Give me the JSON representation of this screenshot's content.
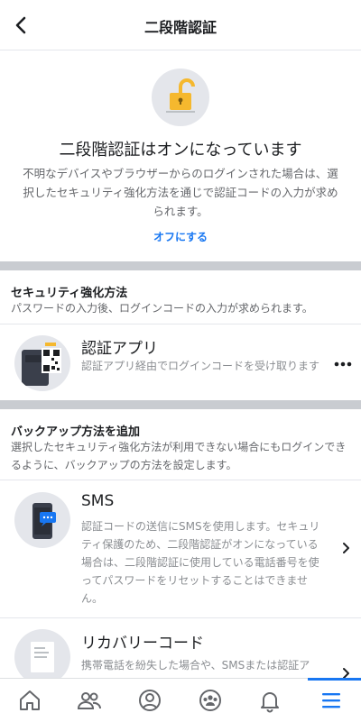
{
  "header": {
    "title": "二段階認証"
  },
  "status": {
    "title": "二段階認証はオンになっています",
    "description": "不明なデバイスやブラウザーからのログインされた場合は、選択したセキュリティ強化方法を通じで認証コードの入力が求められます。",
    "turn_off_label": "オフにする"
  },
  "security_method": {
    "heading": "セキュリティ強化方法",
    "description": "パスワードの入力後、ログインコードの入力が求められます。",
    "item": {
      "title": "認証アプリ",
      "description": "認証アプリ経由でログインコードを受け取ります"
    }
  },
  "backup": {
    "heading": "バックアップ方法を追加",
    "description": "選択したセキュリティ強化方法が利用できない場合にもログインできるように、バックアップの方法を設定します。",
    "items": [
      {
        "title": "SMS",
        "description": "認証コードの送信にSMSを使用します。セキュリティ保護のため、二段階認証がオンになっている場合は、二段階認証に使用している電話番号を使ってパスワードをリセットすることはできません。"
      },
      {
        "title": "リカバリーコード",
        "description": "携帯電話を紛失した場合や、SMSまたは認証ア"
      }
    ]
  },
  "tabbar": {
    "tabs": [
      "home-icon",
      "friends-icon",
      "profile-icon",
      "groups-icon",
      "notifications-icon",
      "menu-icon"
    ],
    "active": "menu-icon",
    "accent": "#1877f2"
  },
  "colors": {
    "link": "#1877f2",
    "lock": "#f5b82e",
    "separator": "#c9ccd1"
  }
}
